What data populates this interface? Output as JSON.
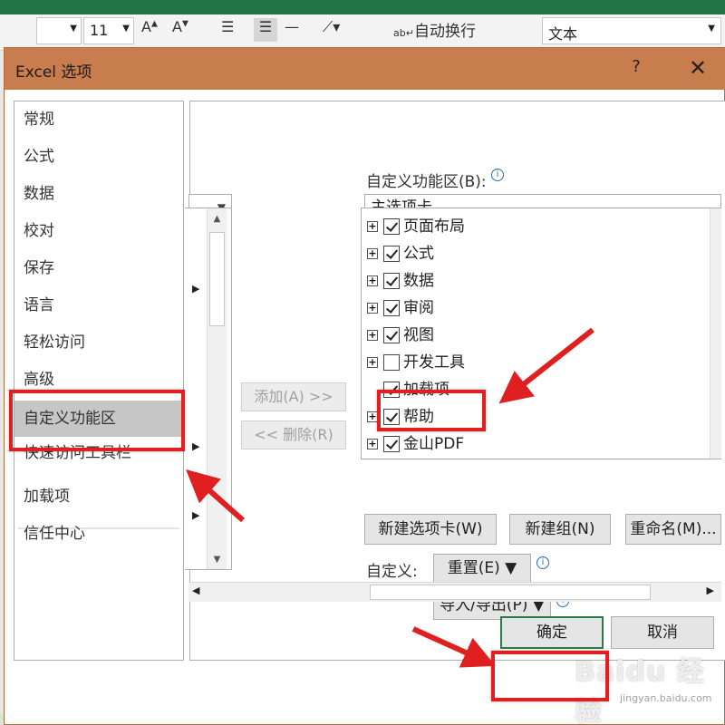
{
  "ribbon": {
    "font_size": "11",
    "wrap_text": "自动换行",
    "number_format": "文本"
  },
  "dialog": {
    "title": "Excel 选项",
    "help": "?",
    "close": "✕"
  },
  "categories": [
    {
      "label": "常规",
      "selected": false
    },
    {
      "label": "公式",
      "selected": false
    },
    {
      "label": "数据",
      "selected": false
    },
    {
      "label": "校对",
      "selected": false
    },
    {
      "label": "保存",
      "selected": false
    },
    {
      "label": "语言",
      "selected": false
    },
    {
      "label": "轻松访问",
      "selected": false
    },
    {
      "label": "高级",
      "selected": false
    },
    {
      "label": "自定义功能区",
      "selected": true
    },
    {
      "label": "快速访问工具栏",
      "selected": false
    },
    {
      "label": "加载项",
      "selected": false
    },
    {
      "label": "信任中心",
      "selected": false
    }
  ],
  "customize": {
    "label": "自定义功能区(B):",
    "selected_tab_set": "主选项卡",
    "add_button": "添加(A) >>",
    "remove_button": "<< 删除(R)",
    "tree_items": [
      {
        "label": "页面布局",
        "checked": true
      },
      {
        "label": "公式",
        "checked": true
      },
      {
        "label": "数据",
        "checked": true
      },
      {
        "label": "审阅",
        "checked": true
      },
      {
        "label": "视图",
        "checked": true
      },
      {
        "label": "开发工具",
        "checked": false
      },
      {
        "label": "加载项",
        "checked": true
      },
      {
        "label": "帮助",
        "checked": true
      },
      {
        "label": "金山PDF",
        "checked": true
      }
    ],
    "new_tab_button": "新建选项卡(W)",
    "new_group_button": "新建组(N)",
    "rename_button": "重命名(M)...",
    "custom_label": "自定义:",
    "reset_button": "重置(E) ▼",
    "import_export_button": "导入/导出(P) ▼"
  },
  "footer": {
    "ok": "确定",
    "cancel": "取消"
  },
  "watermark": {
    "brand": "Baidu 经验",
    "url": "jingyan.baidu.com"
  },
  "colors": {
    "titlebar": "#c87d4f",
    "highlight": "#e02020",
    "ok_border": "#2a7a48"
  }
}
